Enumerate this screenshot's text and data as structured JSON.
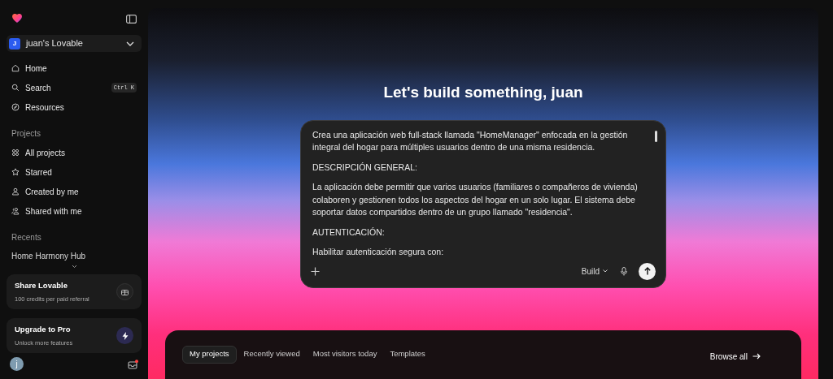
{
  "sidebar": {
    "workspace": {
      "initial": "J",
      "name": "juan's Lovable"
    },
    "nav": [
      {
        "kind": "home",
        "label": "Home"
      },
      {
        "kind": "search",
        "label": "Search",
        "shortcut": "Ctrl K"
      },
      {
        "kind": "compass",
        "label": "Resources"
      }
    ],
    "projects_heading": "Projects",
    "projects": [
      {
        "kind": "grid",
        "label": "All projects"
      },
      {
        "kind": "star",
        "label": "Starred"
      },
      {
        "kind": "user",
        "label": "Created by me"
      },
      {
        "kind": "users",
        "label": "Shared with me"
      }
    ],
    "recents_heading": "Recents",
    "recents": [
      "Home Harmony Hub"
    ],
    "cards": [
      {
        "kind": "gift",
        "title": "Share Lovable",
        "subtitle": "100 credits per paid referral"
      },
      {
        "kind": "bolt",
        "title": "Upgrade to Pro",
        "subtitle": "Unlock more features"
      }
    ],
    "user_initial": "j"
  },
  "main": {
    "heading": "Let's build something, juan",
    "prompt": {
      "paragraphs": [
        "Crea una aplicación web full-stack llamada \"HomeManager\" enfocada en la gestión integral del hogar para múltiples usuarios dentro de una misma residencia.",
        "DESCRIPCIÓN GENERAL:",
        "La aplicación debe permitir que varios usuarios (familiares o compañeros de vivienda) colaboren y gestionen todos los aspectos del hogar en un solo lugar. El sistema debe soportar datos compartidos dentro de un grupo llamado \"residencia\".",
        "AUTENTICACIÓN:",
        "Habilitar autenticación segura con:"
      ],
      "mode": "Build"
    },
    "tabs": [
      {
        "label": "My projects",
        "selected": true
      },
      {
        "label": "Recently viewed",
        "selected": false
      },
      {
        "label": "Most visitors today",
        "selected": false
      },
      {
        "label": "Templates",
        "selected": false
      }
    ],
    "browse_all": "Browse all"
  }
}
